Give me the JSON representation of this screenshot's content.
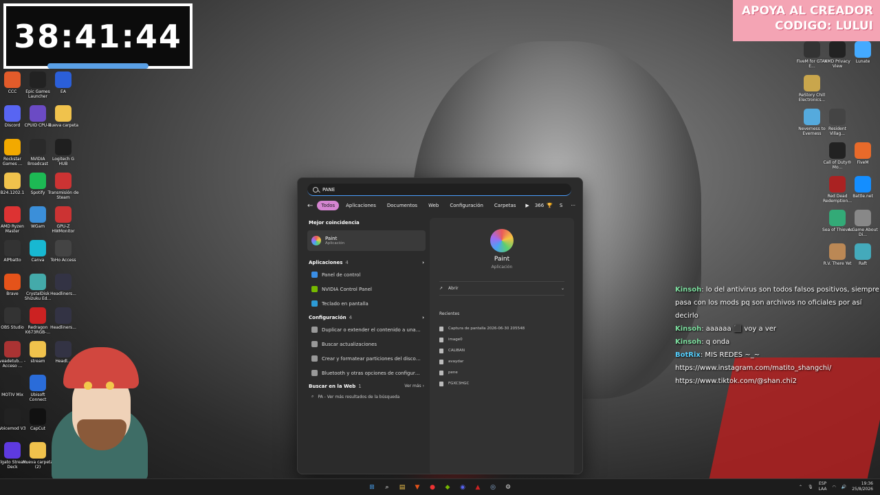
{
  "timer": {
    "text": "38:41:44"
  },
  "banner": {
    "line1": "APOYA AL CREADOR",
    "line2": "CODIGO: LULUI"
  },
  "desktop_left": [
    {
      "label": "CCC",
      "color": "#e25b2a"
    },
    {
      "label": "Epic Games Launcher",
      "color": "#222222"
    },
    {
      "label": "EA",
      "color": "#2b5fd9"
    },
    {
      "label": "Discord",
      "color": "#5865f2"
    },
    {
      "label": "CPUID CPU-Z",
      "color": "#6b4bc4"
    },
    {
      "label": "Nueva carpeta",
      "color": "#f0c24c"
    },
    {
      "label": "Rockstar Games ...",
      "color": "#f2a900"
    },
    {
      "label": "NVIDIA Broadcast",
      "color": "#2a2a2a"
    },
    {
      "label": "Logitech G HUB",
      "color": "#1f1f1f"
    },
    {
      "label": "B24.1202.1",
      "color": "#f0c24c"
    },
    {
      "label": "Spotify",
      "color": "#1db954"
    },
    {
      "label": "Transmisión de Steam",
      "color": "#c33"
    },
    {
      "label": "AMD Ryzen Master",
      "color": "#d33"
    },
    {
      "label": "WGam",
      "color": "#3b8fd9"
    },
    {
      "label": "GPU-Z HWMonitor",
      "color": "#c33"
    },
    {
      "label": "AlPbatto",
      "color": "#333"
    },
    {
      "label": "Canva",
      "color": "#18b8d2"
    },
    {
      "label": "ToHo Access",
      "color": "#444"
    },
    {
      "label": "Brave",
      "color": "#e5531a"
    },
    {
      "label": "CrystalDisk Shizuku Ed...",
      "color": "#4aa"
    },
    {
      "label": "Headliners...",
      "color": "#334"
    },
    {
      "label": "OBS Studio",
      "color": "#333"
    },
    {
      "label": "Redragon K673RGB-...",
      "color": "#c22"
    },
    {
      "label": "Headliners...",
      "color": "#334"
    },
    {
      "label": "veadetub... - Acceso ...",
      "color": "#a33"
    },
    {
      "label": "stream",
      "color": "#f0c24c"
    },
    {
      "label": "Headl...",
      "color": "#334"
    },
    {
      "label": "MOTIV Mix",
      "color": "#222"
    },
    {
      "label": "Ubisoft Connect",
      "color": "#2a6cd9"
    },
    {
      "label": "",
      "color": "#000000"
    },
    {
      "label": "Voicemod V3",
      "color": "#222"
    },
    {
      "label": "CapCut",
      "color": "#111"
    },
    {
      "label": "",
      "color": "#000000"
    },
    {
      "label": "Elgato Stream Deck",
      "color": "#5e3ae0"
    },
    {
      "label": "Nueva carpeta (2)",
      "color": "#f0c24c"
    }
  ],
  "desktop_right": [
    {
      "label": "FiveM for GTAV E...",
      "color": "#333"
    },
    {
      "label": "AMD Privacy View",
      "color": "#222"
    },
    {
      "label": "Lunate",
      "color": "#4af"
    },
    {
      "label": "ReStory Chill Electronics...",
      "color": "#c9a64c"
    },
    {
      "label": "",
      "color": "#000000"
    },
    {
      "label": "",
      "color": "#000000"
    },
    {
      "label": "Neverness to Everness",
      "color": "#5ad"
    },
    {
      "label": "Resident Villag...",
      "color": "#444"
    },
    {
      "label": "",
      "color": "#000000"
    },
    {
      "label": "",
      "color": "#000000"
    },
    {
      "label": "Call of Duty® Mo...",
      "color": "#222"
    },
    {
      "label": "FiveM",
      "color": "#e86a2a"
    },
    {
      "label": "",
      "color": "#000000"
    },
    {
      "label": "Red Dead Redemption...",
      "color": "#a22"
    },
    {
      "label": "Battle.net",
      "color": "#148eff"
    },
    {
      "label": "",
      "color": "#000000"
    },
    {
      "label": "Sea of Thieves",
      "color": "#3a7"
    },
    {
      "label": "A Game About Di...",
      "color": "#888"
    },
    {
      "label": "",
      "color": "#000000"
    },
    {
      "label": "R.V. There Yet",
      "color": "#b85"
    },
    {
      "label": "Raft",
      "color": "#4ab"
    }
  ],
  "search": {
    "query": "PANE",
    "filters": [
      "Todos",
      "Aplicaciones",
      "Documentos",
      "Web",
      "Configuración",
      "Carpetas"
    ],
    "points": "366",
    "avatar_letter": "S",
    "more": "···",
    "best_match_header": "Mejor coincidencia",
    "best_match": {
      "title": "Paint",
      "subtitle": "Aplicación"
    },
    "apps_header": "Aplicaciones",
    "apps_count": "4",
    "apps": [
      {
        "label": "Panel de control",
        "color": "#3a8ee6"
      },
      {
        "label": "NVIDIA Control Panel",
        "color": "#76b900"
      },
      {
        "label": "Teclado en pantalla",
        "color": "#2d9bd6"
      }
    ],
    "settings_header": "Configuración",
    "settings_count": "4",
    "settings": [
      {
        "label": "Duplicar o extender el contenido a una pant...",
        "color": "#999"
      },
      {
        "label": "Buscar actualizaciones",
        "color": "#999"
      },
      {
        "label": "Crear y formatear particiones del disco duro",
        "color": "#999"
      },
      {
        "label": "Bluetooth y otras opciones de configuración...",
        "color": "#999"
      }
    ],
    "web_header": "Buscar en la Web",
    "web_count": "1",
    "web_see_more": "Ver más",
    "web_result": "PA - Ver más resultados de la búsqueda",
    "preview": {
      "title": "Paint",
      "subtitle": "Aplicación",
      "open_label": "Abrir",
      "recent_header": "Recientes",
      "recent_files": [
        "Captura de pantalla 2026-06-30 205548",
        "image0",
        "CALIBAN",
        "avaydar",
        "pene",
        "FGXC3HGC"
      ]
    }
  },
  "chat": [
    {
      "user": "Kinsoh",
      "msg": ": lo del antivirus son todos falsos positivos, siempre pasa con los mods pq son archivos no oficiales por así decirlo"
    },
    {
      "user": "Kinsoh",
      "msg": ": aaaaaa ⬛ voy a ver"
    },
    {
      "user": "Kinsoh",
      "msg": ": q onda"
    },
    {
      "user": "BotRix",
      "msg": ": MIS REDES ~_~ https://www.instagram.com/matito_shangchi/ https://www.tiktok.com/@shan.chi2"
    }
  ],
  "taskbar": {
    "icons": [
      {
        "name": "start-icon",
        "glyph": "⊞",
        "color": "#4aa3f2"
      },
      {
        "name": "search-icon",
        "glyph": "⌕",
        "color": "#ffffff"
      },
      {
        "name": "files-icon",
        "glyph": "▤",
        "color": "#f0c24c"
      },
      {
        "name": "brave-icon",
        "glyph": "▼",
        "color": "#e5531a"
      },
      {
        "name": "record-icon",
        "glyph": "●",
        "color": "#e33"
      },
      {
        "name": "app-icon",
        "glyph": "◆",
        "color": "#76b900"
      },
      {
        "name": "discord-icon",
        "glyph": "◉",
        "color": "#5865f2"
      },
      {
        "name": "redragon-icon",
        "glyph": "▲",
        "color": "#c22"
      },
      {
        "name": "steam-icon",
        "glyph": "◎",
        "color": "#8fb1d9"
      },
      {
        "name": "settings-icon",
        "glyph": "⚙",
        "color": "#ddd"
      }
    ],
    "lang_top": "ESP",
    "lang_bottom": "LAA",
    "time": "19:36",
    "date": "25/8/2026"
  }
}
